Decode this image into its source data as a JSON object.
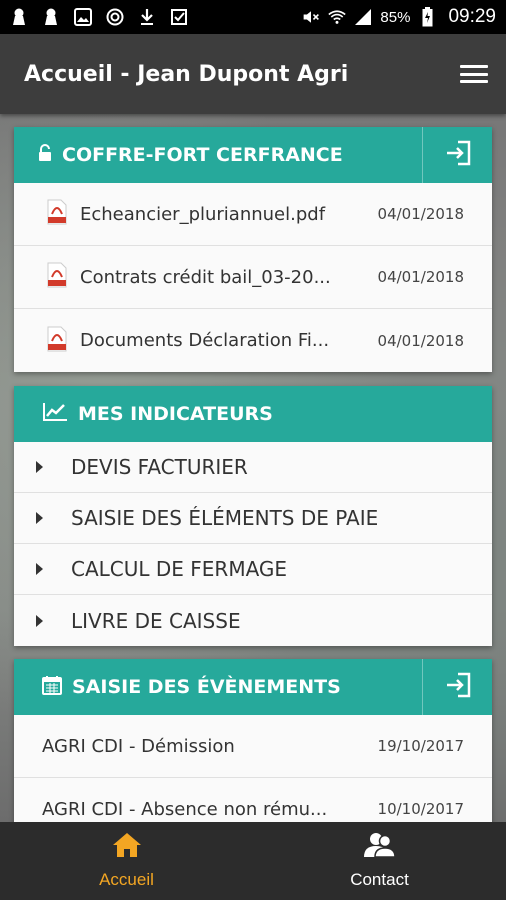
{
  "status_bar": {
    "battery": "85%",
    "time": "09:29"
  },
  "app_bar": {
    "title": "Accueil - Jean Dupont Agri"
  },
  "safe_card": {
    "title": "COFFRE-FORT CERFRANCE",
    "documents": [
      {
        "name": "Echeancier_pluriannuel.pdf",
        "date": "04/01/2018"
      },
      {
        "name": "Contrats crédit bail_03-20...",
        "date": "04/01/2018"
      },
      {
        "name": "Documents Déclaration Fi...",
        "date": "04/01/2018"
      }
    ]
  },
  "indicators_card": {
    "title": "MES INDICATEURS",
    "items": [
      "DEVIS FACTURIER",
      "SAISIE DES ÉLÉMENTS DE PAIE",
      "CALCUL DE FERMAGE",
      "LIVRE DE CAISSE"
    ]
  },
  "events_card": {
    "title": "SAISIE DES ÉVÈNEMENTS",
    "events": [
      {
        "name": "AGRI CDI - Démission",
        "date": "19/10/2017"
      },
      {
        "name": "AGRI CDI - Absence non rému...",
        "date": "10/10/2017"
      }
    ]
  },
  "bottom_nav": {
    "home_label": "Accueil",
    "contact_label": "Contact"
  },
  "colors": {
    "accent": "#26a99b",
    "active_nav": "#f3a623",
    "app_bar": "#3d3d3d",
    "pdf_icon": "#d23a2a"
  }
}
